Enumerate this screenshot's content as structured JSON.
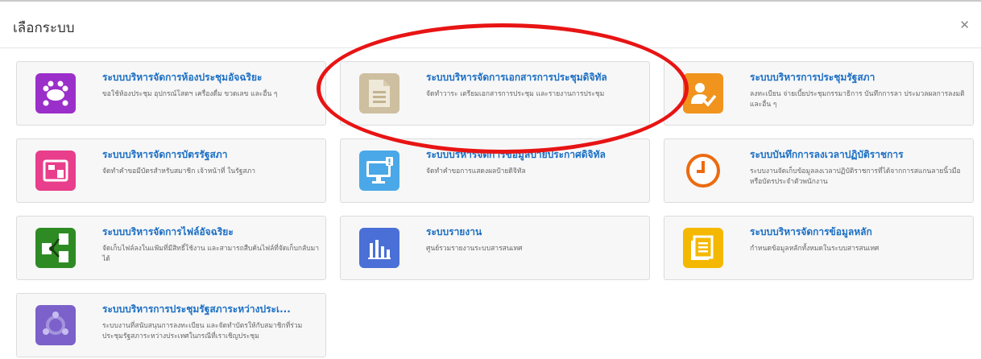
{
  "window": {
    "title": "เลือกระบบ",
    "close_icon": "close-icon"
  },
  "cards": [
    {
      "title": "ระบบบริหารจัดการห้องประชุมอัจฉริยะ",
      "desc": "ขอใช้ห้องประชุม อุปกรณ์โสตฯ เครื่องดื่ม ขวดเลข และอื่น ๆ",
      "icon": "meeting-room-icon",
      "color": "#9b2fc9"
    },
    {
      "title": "ระบบบริหารจัดการเอกสารการประชุมดิจิทัล",
      "desc": "จัดทำวาระ เตรียมเอกสารการประชุม และรายงานการประชุม",
      "icon": "document-icon",
      "color": "#cdbf9f"
    },
    {
      "title": "ระบบบริหารการประชุมรัฐสภา",
      "desc": "ลงทะเบียน จ่ายเบี้ยประชุมกรรมาธิการ บันทึกการลา ประมวลผลการลงมติ และอื่น ๆ",
      "icon": "user-check-icon",
      "color": "#f0941e"
    },
    {
      "title": "ระบบบริหารจัดการบัตรรัฐสภา",
      "desc": "จัดทำคำขอมีบัตรสำหรับสมาชิก เจ้าหน้าที่ ในรัฐสภา",
      "icon": "id-card-icon",
      "color": "#e83e8c"
    },
    {
      "title": "ระบบบริหารจัดการข้อมูลป้ายประกาศดิจิทัล",
      "desc": "จัดทำคำขอการแสดงผลป้ายดิจิทัล",
      "icon": "monitor-alert-icon",
      "color": "#4aa8e8"
    },
    {
      "title": "ระบบบันทึกการลงเวลาปฏิบัติราชการ",
      "desc": "ระบบงานจัดเก็บข้อมูลลงเวลาปฏิบัติราชการที่ได้จากการสแกนลายนิ้วมือ หรือบัตรประจำตัวพนักงาน",
      "icon": "clock-icon",
      "color": "#ffffff"
    },
    {
      "title": "ระบบบริหารจัดการไฟล์อัจฉริยะ",
      "desc": "จัดเก็บไฟล์ลงในแฟ้มที่มีสิทธิ์ใช้งาน และสามารถสืบค้นไฟล์ที่จัดเก็บกลับมาได้",
      "icon": "file-share-icon",
      "color": "#2e8b24"
    },
    {
      "title": "ระบบรายงาน",
      "desc": "ศูนย์รวมรายงานระบบสารสนเทศ",
      "icon": "bar-chart-icon",
      "color": "#4a6fd6"
    },
    {
      "title": "ระบบบริหารจัดการข้อมูลหลัก",
      "desc": "กำหนดข้อมูลหลักทั้งหมดในระบบสารสนเทศ",
      "icon": "list-document-icon",
      "color": "#f5b800"
    },
    {
      "title": "ระบบบริหารการประชุมรัฐสภาระหว่างประเ...",
      "desc": "ระบบงานที่สนับสนุนการลงทะเบียน และจัดทำบัตรให้กับสมาชิกที่ร่วมประชุมรัฐสภาระหว่างประเทศในกรณีที่เราเชิญประชุม",
      "icon": "people-group-icon",
      "color": "#7b61c9"
    }
  ],
  "colors": {
    "accent_title": "#1c6fc4",
    "highlight_oval": "#e81414"
  }
}
